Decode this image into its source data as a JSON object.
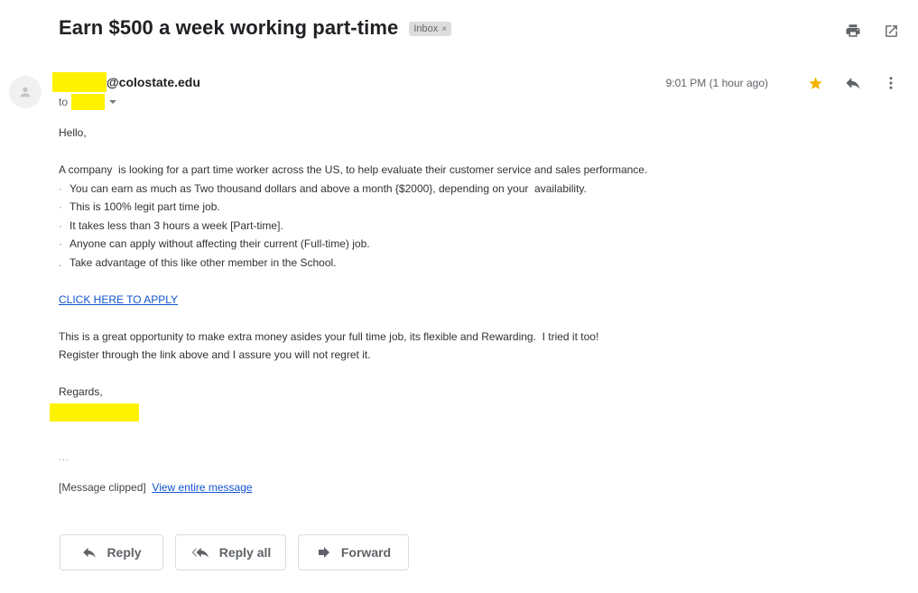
{
  "email": {
    "subject": "Earn $500 a week working part-time",
    "label": {
      "name": "Inbox",
      "remove_icon": "×"
    },
    "header_actions": [
      {
        "name": "print-all",
        "icon": "printer-icon"
      },
      {
        "name": "open-in-new-window",
        "icon": "external-link-icon"
      }
    ],
    "sender": {
      "name_redacted": true,
      "email_suffix": "@colostate.edu",
      "avatar_icon": "person-icon"
    },
    "recipient": {
      "to_label": "to",
      "name_redacted": true
    },
    "timestamp": "9:01 PM (1 hour ago)",
    "starred": true,
    "colors": {
      "star": "#f4b400",
      "link": "#1155cc",
      "redaction": "#fff200",
      "chip_bg": "#dddddd"
    },
    "body": {
      "greeting": "Hello,",
      "intro": "A company  is looking for a part time worker across the US, to help evaluate their customer service and sales performance.",
      "bullets": [
        {
          "marker": "·",
          "text": "You can earn as much as Two thousand dollars and above a month {$2000}, depending on your  availability."
        },
        {
          "marker": "·",
          "text": "This is 100% legit part time job."
        },
        {
          "marker": "·",
          "text": "It takes less than 3 hours a week [Part-time]."
        },
        {
          "marker": "·",
          "text": "Anyone can apply without affecting their current (Full-time) job."
        },
        {
          "marker": ".",
          "text": "Take advantage of this like other member in the School."
        }
      ],
      "apply_link": "CLICK HERE TO APPLY",
      "closing_1": "This is a great opportunity to make extra money asides your full time job, its flexible and Rewarding.  I tried it too!",
      "closing_2": "Register through the link above and I assure you will not regret it.",
      "signoff": "Regards,",
      "signature_redacted": true,
      "trimmed": "...",
      "clipped_note": "[Message clipped]",
      "view_entire": "View entire message"
    },
    "footer_buttons": {
      "reply": "Reply",
      "reply_all": "Reply all",
      "forward": "Forward"
    }
  }
}
